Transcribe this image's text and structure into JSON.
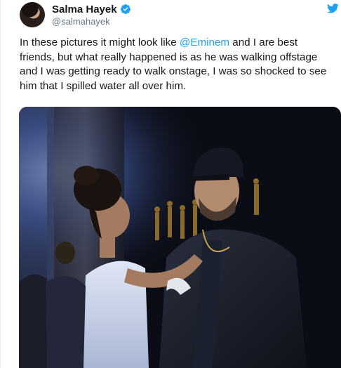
{
  "user": {
    "display_name": "Salma Hayek",
    "handle": "@salmahayek",
    "verified": true
  },
  "tweet": {
    "text_before_mention": "In these pictures it might look like ",
    "mention": "@Eminem",
    "text_after_mention": " and I are best friends, but what really happened is as he was walking offstage and I was getting ready to walk onstage, I was so shocked to see him that I spilled water all over him."
  },
  "icons": {
    "verified": "verified-badge-icon",
    "platform": "twitter-bird-icon"
  },
  "colors": {
    "brand_blue": "#1da1f2",
    "text_primary": "#14171a",
    "text_secondary": "#657786"
  }
}
